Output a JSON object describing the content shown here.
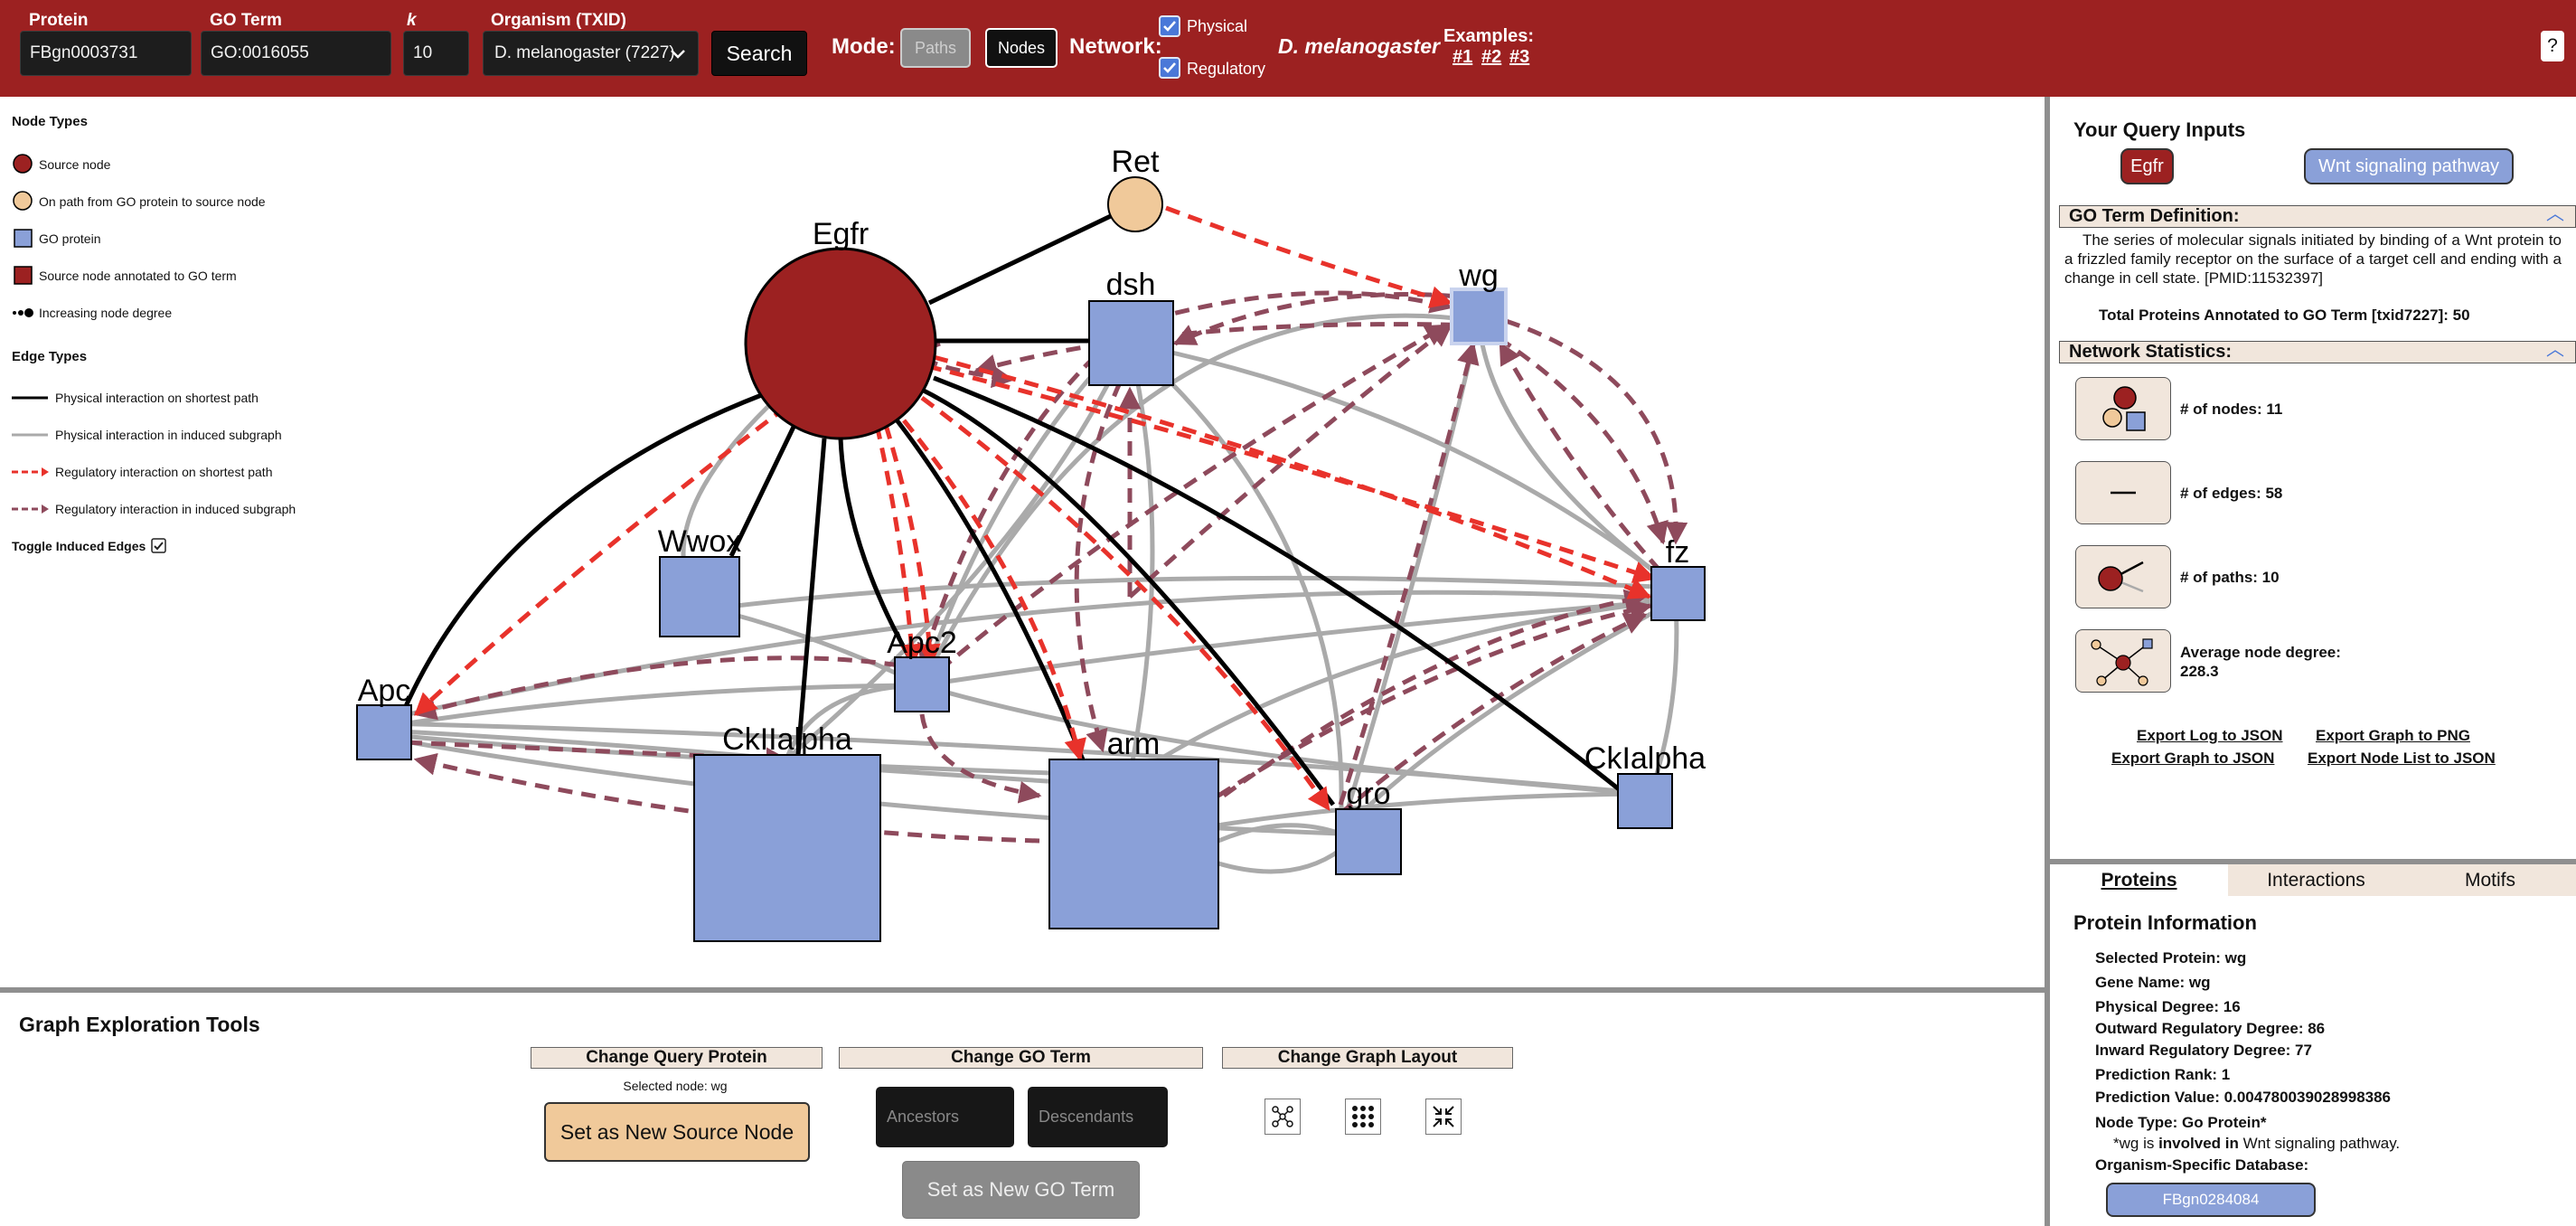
{
  "topbar": {
    "protein_label": "Protein",
    "protein_value": "FBgn0003731",
    "goterm_label": "GO Term",
    "goterm_value": "GO:0016055",
    "k_label": "k",
    "k_value": "10",
    "organism_label": "Organism (TXID)",
    "organism_value": "D. melanogaster (7227)",
    "search_label": "Search",
    "mode_label": "Mode:",
    "mode_paths": "Paths",
    "mode_nodes": "Nodes",
    "network_label": "Network:",
    "physical_label": "Physical",
    "regulatory_label": "Regulatory",
    "species": "D. melanogaster",
    "examples_label": "Examples:",
    "examples": [
      "#1",
      "#2",
      "#3"
    ],
    "help": "?"
  },
  "legend": {
    "node_types_title": "Node Types",
    "source_node": "Source node",
    "on_path": "On path from GO protein to source node",
    "go_protein": "GO protein",
    "source_annotated": "Source node annotated to GO term",
    "node_degree": "Increasing node degree",
    "edge_types_title": "Edge Types",
    "phys_shortest": "Physical interaction on shortest path",
    "phys_induced": "Physical interaction in induced subgraph",
    "reg_shortest": "Regulatory interaction on shortest path",
    "reg_induced": "Regulatory interaction in induced subgraph",
    "toggle_induced": "Toggle Induced Edges"
  },
  "graph": {
    "colors": {
      "source": "#9c2121",
      "on_path": "#f0c99a",
      "go_protein": "#8aa0d8",
      "phys_short": "#000000",
      "phys_induced": "#aaaaaa",
      "reg_short": "#e8322b",
      "reg_induced": "#8e4a5c"
    },
    "nodes": {
      "ret": "Ret",
      "egfr": "Egfr",
      "wg": "wg",
      "dsh": "dsh",
      "wwox": "Wwox",
      "apc": "Apc",
      "apc2": "Apc2",
      "ck2": "CkIIalpha",
      "arm": "arm",
      "gro": "gro",
      "ck1": "CkIalpha",
      "fz": "fz"
    }
  },
  "tools": {
    "title": "Graph Exploration Tools",
    "change_query_protein": "Change Query Protein",
    "change_go_term": "Change GO Term",
    "change_graph_layout": "Change Graph Layout",
    "selected_node": "Selected node: wg",
    "set_source": "Set as New Source Node",
    "ancestors": "Ancestors",
    "descendants": "Descendants",
    "set_go": "Set as New GO Term"
  },
  "right_panel": {
    "query_inputs_title": "Your Query Inputs",
    "query_protein": "Egfr",
    "query_goterm": "Wnt signaling pathway",
    "go_def_title": "GO Term Definition:",
    "go_def_text": "The series of molecular signals initiated by binding of a Wnt protein to a frizzled family receptor on the surface of a target cell and ending with a change in cell state. [PMID:11532397]",
    "go_total": "Total Proteins Annotated to GO Term [txid7227]: 50",
    "net_stats_title": "Network Statistics:",
    "stat_nodes": "# of nodes: 11",
    "stat_edges": "# of edges: 58",
    "stat_paths": "# of paths: 10",
    "stat_avg_label": "Average node degree:",
    "stat_avg_value": "228.3",
    "export_log": "Export Log to JSON",
    "export_png": "Export Graph to PNG",
    "export_graph_json": "Export Graph to JSON",
    "export_nodelist": "Export Node List to JSON",
    "tabs": [
      "Proteins",
      "Interactions",
      "Motifs"
    ],
    "protein_info_title": "Protein Information",
    "selected_protein": "Selected Protein: wg",
    "gene_name": "Gene Name: wg",
    "physical_degree": "Physical Degree: 16",
    "outward_reg": "Outward Regulatory Degree: 86",
    "inward_reg": "Inward Regulatory Degree: 77",
    "pred_rank": "Prediction Rank: 1",
    "pred_value": "Prediction Value: 0.004780039028998386",
    "node_type": "Node Type: Go Protein*",
    "note_prefix": "*wg is ",
    "note_bold": "involved in",
    "note_suffix": " Wnt signaling pathway.",
    "org_db_label": "Organism-Specific Database:",
    "org_db_value": "FBgn0284084"
  }
}
